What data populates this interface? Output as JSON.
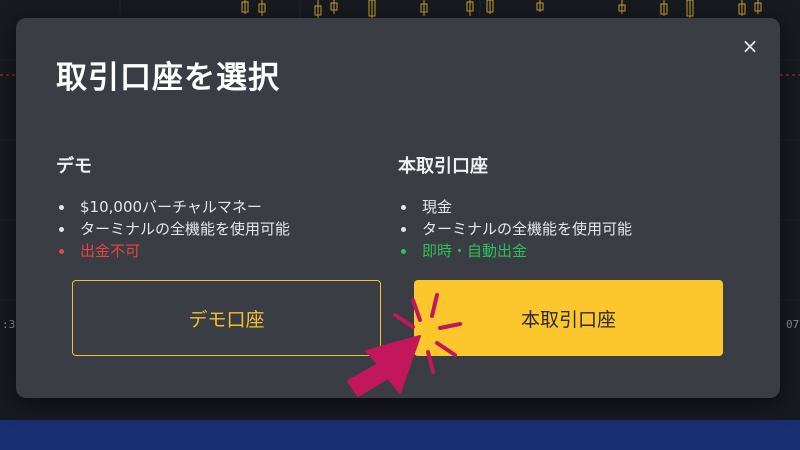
{
  "modal": {
    "title": "取引口座を選択",
    "close_glyph": "×",
    "demo": {
      "title": "デモ",
      "features": [
        {
          "text": "$10,000バーチャルマネー",
          "tone": "normal"
        },
        {
          "text": "ターミナルの全機能を使用可能",
          "tone": "normal"
        },
        {
          "text": "出金不可",
          "tone": "negative"
        }
      ],
      "button_label": "デモ口座"
    },
    "real": {
      "title": "本取引口座",
      "features": [
        {
          "text": "現金",
          "tone": "normal"
        },
        {
          "text": "ターミナルの全機能を使用可能",
          "tone": "normal"
        },
        {
          "text": "即時・自動出金",
          "tone": "positive"
        }
      ],
      "button_label": "本取引口座"
    }
  },
  "background": {
    "axis_label_left": ":3",
    "axis_label_right": "07"
  },
  "colors": {
    "accent": "#fcc72c",
    "negative": "#e64545",
    "positive": "#2fbf5a",
    "pointer": "#c2185b"
  },
  "icons": {
    "close": "close-icon",
    "pointer": "hand-pointer-icon"
  }
}
